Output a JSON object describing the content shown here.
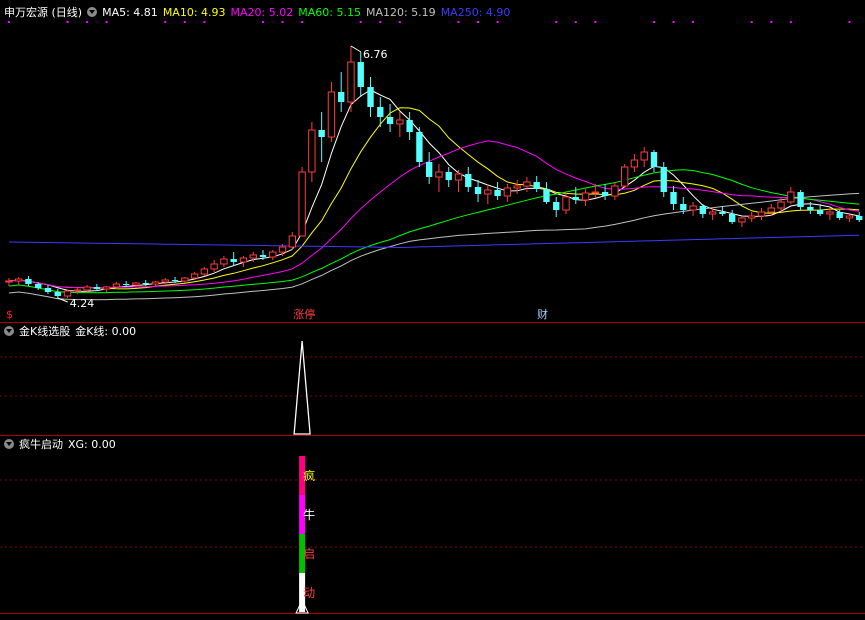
{
  "panels": {
    "main": {
      "title": "申万宏源 (日线)",
      "mas": [
        {
          "label": "MA5: 4.81",
          "color": "#ffffff"
        },
        {
          "label": "MA10: 4.93",
          "color": "#ffff00"
        },
        {
          "label": "MA20: 5.02",
          "color": "#ff00ff"
        },
        {
          "label": "MA60: 5.15",
          "color": "#00ff00"
        },
        {
          "label": "MA120: 5.19",
          "color": "#c0c0c0"
        },
        {
          "label": "MA250: 4.90",
          "color": "#3b3bff"
        }
      ],
      "high_label": "6.76",
      "low_label": "4.24",
      "markers": {
        "dollar": "$",
        "event1": "涨停",
        "event2": "财"
      }
    },
    "sub1": {
      "title": "金K线选股",
      "value_label": "金K线: 0.00"
    },
    "sub2": {
      "title": "疯牛启动",
      "value_label": "XG: 0.00",
      "bar_text": [
        "疯",
        "牛",
        "启",
        "动"
      ]
    }
  },
  "colors": {
    "up": "#ff3c3c",
    "down": "#54ffff",
    "separator": "#b00000",
    "grid": "#8b0000",
    "ma": [
      "#ffffff",
      "#ffff00",
      "#ff00ff",
      "#00ff00",
      "#c0c0c0",
      "#3b3bff"
    ],
    "bar_segments": [
      "#ff0080",
      "#ff00ff",
      "#00c000",
      "#ffffff"
    ]
  },
  "chart_data": {
    "type": "candlestick",
    "price_range": [
      4.0,
      7.0
    ],
    "candles": [
      [
        4.4,
        4.44,
        4.36,
        4.41
      ],
      [
        4.41,
        4.45,
        4.37,
        4.43
      ],
      [
        4.43,
        4.46,
        4.36,
        4.38
      ],
      [
        4.38,
        4.4,
        4.32,
        4.34
      ],
      [
        4.34,
        4.37,
        4.28,
        4.3
      ],
      [
        4.3,
        4.33,
        4.24,
        4.26
      ],
      [
        4.26,
        4.32,
        4.24,
        4.31
      ],
      [
        4.31,
        4.34,
        4.28,
        4.32
      ],
      [
        4.32,
        4.37,
        4.3,
        4.35
      ],
      [
        4.35,
        4.38,
        4.31,
        4.33
      ],
      [
        4.33,
        4.36,
        4.3,
        4.35
      ],
      [
        4.35,
        4.4,
        4.33,
        4.38
      ],
      [
        4.38,
        4.41,
        4.35,
        4.37
      ],
      [
        4.37,
        4.4,
        4.34,
        4.39
      ],
      [
        4.39,
        4.42,
        4.36,
        4.38
      ],
      [
        4.38,
        4.41,
        4.36,
        4.4
      ],
      [
        4.4,
        4.44,
        4.38,
        4.42
      ],
      [
        4.42,
        4.45,
        4.39,
        4.41
      ],
      [
        4.41,
        4.45,
        4.39,
        4.44
      ],
      [
        4.44,
        4.5,
        4.42,
        4.48
      ],
      [
        4.48,
        4.55,
        4.46,
        4.53
      ],
      [
        4.53,
        4.62,
        4.5,
        4.58
      ],
      [
        4.58,
        4.66,
        4.55,
        4.63
      ],
      [
        4.63,
        4.7,
        4.56,
        4.6
      ],
      [
        4.6,
        4.66,
        4.55,
        4.64
      ],
      [
        4.64,
        4.7,
        4.6,
        4.67
      ],
      [
        4.67,
        4.72,
        4.62,
        4.65
      ],
      [
        4.65,
        4.72,
        4.62,
        4.7
      ],
      [
        4.7,
        4.78,
        4.66,
        4.75
      ],
      [
        4.75,
        4.9,
        4.72,
        4.86
      ],
      [
        4.86,
        5.55,
        4.86,
        5.5
      ],
      [
        5.5,
        6.0,
        5.4,
        5.92
      ],
      [
        5.92,
        6.1,
        5.6,
        5.85
      ],
      [
        5.85,
        6.4,
        5.8,
        6.3
      ],
      [
        6.3,
        6.5,
        6.1,
        6.2
      ],
      [
        6.2,
        6.76,
        6.1,
        6.6
      ],
      [
        6.6,
        6.7,
        6.25,
        6.35
      ],
      [
        6.35,
        6.45,
        6.05,
        6.15
      ],
      [
        6.15,
        6.25,
        5.95,
        6.05
      ],
      [
        6.05,
        6.18,
        5.9,
        5.98
      ],
      [
        5.98,
        6.1,
        5.85,
        6.02
      ],
      [
        6.02,
        6.1,
        5.82,
        5.9
      ],
      [
        5.9,
        5.95,
        5.55,
        5.6
      ],
      [
        5.6,
        5.7,
        5.38,
        5.45
      ],
      [
        5.45,
        5.58,
        5.3,
        5.5
      ],
      [
        5.5,
        5.55,
        5.35,
        5.42
      ],
      [
        5.42,
        5.52,
        5.3,
        5.48
      ],
      [
        5.48,
        5.55,
        5.3,
        5.35
      ],
      [
        5.35,
        5.42,
        5.2,
        5.28
      ],
      [
        5.28,
        5.38,
        5.18,
        5.32
      ],
      [
        5.32,
        5.4,
        5.22,
        5.26
      ],
      [
        5.26,
        5.38,
        5.2,
        5.34
      ],
      [
        5.34,
        5.42,
        5.28,
        5.36
      ],
      [
        5.36,
        5.45,
        5.3,
        5.4
      ],
      [
        5.4,
        5.46,
        5.3,
        5.33
      ],
      [
        5.33,
        5.4,
        5.18,
        5.2
      ],
      [
        5.2,
        5.25,
        5.05,
        5.12
      ],
      [
        5.12,
        5.3,
        5.08,
        5.25
      ],
      [
        5.25,
        5.35,
        5.18,
        5.22
      ],
      [
        5.22,
        5.33,
        5.16,
        5.29
      ],
      [
        5.29,
        5.38,
        5.24,
        5.3
      ],
      [
        5.3,
        5.38,
        5.22,
        5.26
      ],
      [
        5.26,
        5.4,
        5.22,
        5.36
      ],
      [
        5.36,
        5.58,
        5.34,
        5.55
      ],
      [
        5.55,
        5.68,
        5.5,
        5.62
      ],
      [
        5.62,
        5.75,
        5.55,
        5.7
      ],
      [
        5.7,
        5.72,
        5.5,
        5.55
      ],
      [
        5.55,
        5.6,
        5.25,
        5.3
      ],
      [
        5.3,
        5.36,
        5.12,
        5.18
      ],
      [
        5.18,
        5.25,
        5.08,
        5.12
      ],
      [
        5.12,
        5.2,
        5.06,
        5.16
      ],
      [
        5.16,
        5.18,
        5.04,
        5.08
      ],
      [
        5.08,
        5.14,
        5.02,
        5.1
      ],
      [
        5.1,
        5.16,
        5.06,
        5.08
      ],
      [
        5.08,
        5.12,
        4.98,
        5.0
      ],
      [
        5.0,
        5.06,
        4.95,
        5.04
      ],
      [
        5.04,
        5.1,
        5.0,
        5.06
      ],
      [
        5.06,
        5.14,
        5.02,
        5.1
      ],
      [
        5.1,
        5.18,
        5.06,
        5.14
      ],
      [
        5.14,
        5.24,
        5.1,
        5.2
      ],
      [
        5.2,
        5.35,
        5.18,
        5.3
      ],
      [
        5.3,
        5.32,
        5.12,
        5.15
      ],
      [
        5.15,
        5.2,
        5.08,
        5.12
      ],
      [
        5.12,
        5.18,
        5.06,
        5.08
      ],
      [
        5.08,
        5.14,
        5.02,
        5.1
      ],
      [
        5.1,
        5.12,
        5.02,
        5.04
      ],
      [
        5.04,
        5.08,
        5.0,
        5.06
      ],
      [
        5.06,
        5.1,
        5.0,
        5.02
      ]
    ],
    "indicator1_spike_index": 30,
    "indicator2_signal_index": 30
  }
}
